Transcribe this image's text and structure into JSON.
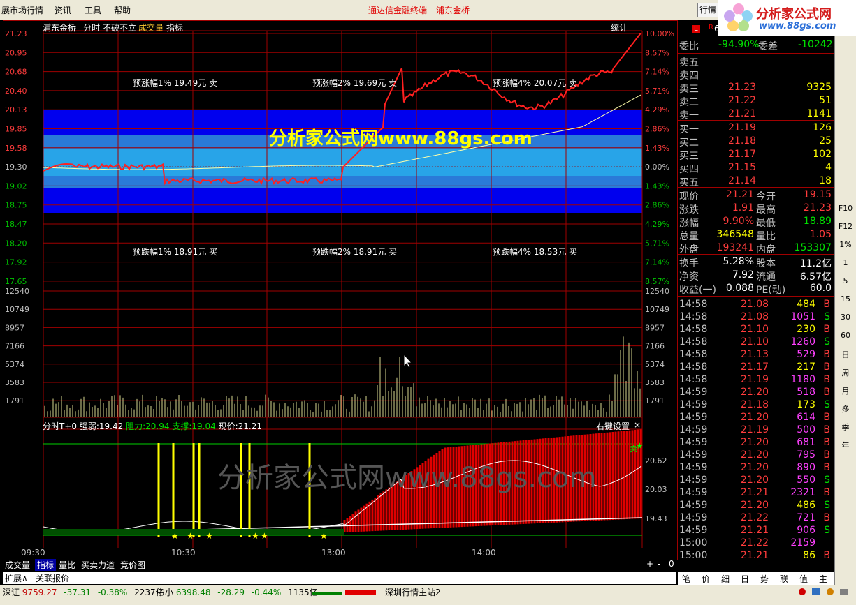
{
  "menu": {
    "items": [
      "展市场行情",
      "资讯",
      "工具",
      "帮助"
    ],
    "title": "通达信金融终端",
    "stock_name": "浦东金桥",
    "right_button": "行情",
    "logo_text": "分析家公式网",
    "logo_url": "www.88gs.com"
  },
  "chart_header": {
    "name": "浦东金桥",
    "items": [
      "分时",
      "不破不立"
    ],
    "volume_label": "成交量",
    "indicator_label": "指标",
    "stats_label": "统计"
  },
  "watermark": "分析家公式网www.88gs.com",
  "watermark2": "分析家公式网www.88gs.com",
  "price_axis_left": [
    "21.23",
    "20.95",
    "20.68",
    "20.40",
    "20.13",
    "19.85",
    "19.58",
    "19.30",
    "19.02",
    "18.75",
    "18.47",
    "18.20",
    "17.92",
    "17.65"
  ],
  "pct_axis_right": [
    "10.00%",
    "8.57%",
    "7.14%",
    "5.71%",
    "4.29%",
    "2.86%",
    "1.43%",
    "0.00%",
    "1.43%",
    "2.86%",
    "4.29%",
    "5.71%",
    "7.14%",
    "8.57%"
  ],
  "vol_axis": [
    "12540",
    "10749",
    "8957",
    "7166",
    "5374",
    "3583",
    "1791"
  ],
  "annotations": {
    "up1": "预涨幅1% 19.49元 卖",
    "up2": "预涨幅2% 19.69元 卖",
    "up4": "预涨幅4% 20.07元 卖",
    "down1": "预跌幅1% 18.91元 买",
    "down2": "预跌幅2% 18.91元 买",
    "down4": "预跌幅4% 18.53元 买"
  },
  "indicator": {
    "name": "分时T+0",
    "strength_label": "强弱:",
    "strength": "19.42",
    "resist_label": "阻力:",
    "resist": "20.94",
    "support_label": "支撑:",
    "support": "19.04",
    "price_label": "现价:",
    "price": "21.21",
    "settings": "右键设置",
    "close": "×",
    "axis": [
      "20.62",
      "20.03",
      "19.43"
    ],
    "sell_marker": "卖"
  },
  "time_axis": [
    "09:30",
    "10:30",
    "13:00",
    "14:00"
  ],
  "bottom_tabs": [
    "成交量",
    "指标",
    "量比",
    "买卖力道",
    "竞价图"
  ],
  "bottom_tabs2": [
    "扩展∧",
    "关联报价"
  ],
  "zoom_controls": [
    "+",
    "-",
    "0"
  ],
  "status": {
    "sz_label": "深证",
    "sz_index": "9759.27",
    "sz_change": "-37.31",
    "sz_pct": "-0.38%",
    "sz_amount": "2237亿",
    "zx_label": "中小",
    "zx_index": "6398.48",
    "zx_change": "-28.29",
    "zx_pct": "-0.44%",
    "zx_amount": "1135亿",
    "server": "深圳行情主站2"
  },
  "quote": {
    "code_prefix": "60",
    "webi_label": "委比",
    "webi": "-94.90%",
    "weicha_label": "委差",
    "weicha": "-10242",
    "sells": [
      {
        "label": "卖五",
        "price": "",
        "vol": ""
      },
      {
        "label": "卖四",
        "price": "",
        "vol": ""
      },
      {
        "label": "卖三",
        "price": "21.23",
        "vol": "9325"
      },
      {
        "label": "卖二",
        "price": "21.22",
        "vol": "51"
      },
      {
        "label": "卖一",
        "price": "21.21",
        "vol": "1141"
      }
    ],
    "buys": [
      {
        "label": "买一",
        "price": "21.19",
        "vol": "126"
      },
      {
        "label": "买二",
        "price": "21.18",
        "vol": "25"
      },
      {
        "label": "买三",
        "price": "21.17",
        "vol": "102"
      },
      {
        "label": "买四",
        "price": "21.15",
        "vol": "4"
      },
      {
        "label": "买五",
        "price": "21.14",
        "vol": "18"
      }
    ],
    "stats": [
      {
        "l1": "现价",
        "v1": "21.21",
        "c1": "red",
        "l2": "今开",
        "v2": "19.15",
        "c2": "red"
      },
      {
        "l1": "涨跌",
        "v1": "1.91",
        "c1": "red",
        "l2": "最高",
        "v2": "21.23",
        "c2": "red"
      },
      {
        "l1": "涨幅",
        "v1": "9.90%",
        "c1": "red",
        "l2": "最低",
        "v2": "18.89",
        "c2": "grn"
      },
      {
        "l1": "总量",
        "v1": "346548",
        "c1": "yel",
        "l2": "量比",
        "v2": "1.05",
        "c2": "red"
      },
      {
        "l1": "外盘",
        "v1": "193241",
        "c1": "red",
        "l2": "内盘",
        "v2": "153307",
        "c2": "grn"
      }
    ],
    "stats2": [
      {
        "l1": "换手",
        "v1": "5.28%",
        "l2": "股本",
        "v2": "11.2亿"
      },
      {
        "l1": "净资",
        "v1": "7.92",
        "l2": "流通",
        "v2": "6.57亿"
      },
      {
        "l1": "收益(一)",
        "v1": "0.088",
        "l2": "PE(动)",
        "v2": "60.0"
      }
    ],
    "ticks": [
      {
        "t": "14:58",
        "p": "21.08",
        "v": "484",
        "bs": "B"
      },
      {
        "t": "14:58",
        "p": "21.08",
        "v": "1051",
        "bs": "S"
      },
      {
        "t": "14:58",
        "p": "21.10",
        "v": "230",
        "bs": "B"
      },
      {
        "t": "14:58",
        "p": "21.10",
        "v": "1260",
        "bs": "S"
      },
      {
        "t": "14:58",
        "p": "21.13",
        "v": "529",
        "bs": "B"
      },
      {
        "t": "14:58",
        "p": "21.17",
        "v": "217",
        "bs": "B"
      },
      {
        "t": "14:58",
        "p": "21.19",
        "v": "1180",
        "bs": "B"
      },
      {
        "t": "14:59",
        "p": "21.20",
        "v": "518",
        "bs": "B"
      },
      {
        "t": "14:59",
        "p": "21.18",
        "v": "173",
        "bs": "S"
      },
      {
        "t": "14:59",
        "p": "21.20",
        "v": "614",
        "bs": "B"
      },
      {
        "t": "14:59",
        "p": "21.19",
        "v": "500",
        "bs": "B"
      },
      {
        "t": "14:59",
        "p": "21.20",
        "v": "681",
        "bs": "B"
      },
      {
        "t": "14:59",
        "p": "21.20",
        "v": "795",
        "bs": "B"
      },
      {
        "t": "14:59",
        "p": "21.20",
        "v": "890",
        "bs": "B"
      },
      {
        "t": "14:59",
        "p": "21.20",
        "v": "550",
        "bs": "S"
      },
      {
        "t": "14:59",
        "p": "21.21",
        "v": "2321",
        "bs": "B"
      },
      {
        "t": "14:59",
        "p": "21.20",
        "v": "486",
        "bs": "S"
      },
      {
        "t": "14:59",
        "p": "21.22",
        "v": "721",
        "bs": "B"
      },
      {
        "t": "14:59",
        "p": "21.21",
        "v": "906",
        "bs": "S"
      },
      {
        "t": "15:00",
        "p": "21.22",
        "v": "2159",
        "bs": ""
      },
      {
        "t": "15:00",
        "p": "21.21",
        "v": "86",
        "bs": "B"
      }
    ],
    "bottom_tabs": [
      "笔",
      "价",
      "细",
      "日",
      "势",
      "联",
      "值",
      "主"
    ]
  },
  "rightbar": [
    "F10",
    "F12",
    "1%",
    "1",
    "5",
    "15",
    "30",
    "60",
    "日",
    "周",
    "月",
    "多",
    "季",
    "年"
  ]
}
